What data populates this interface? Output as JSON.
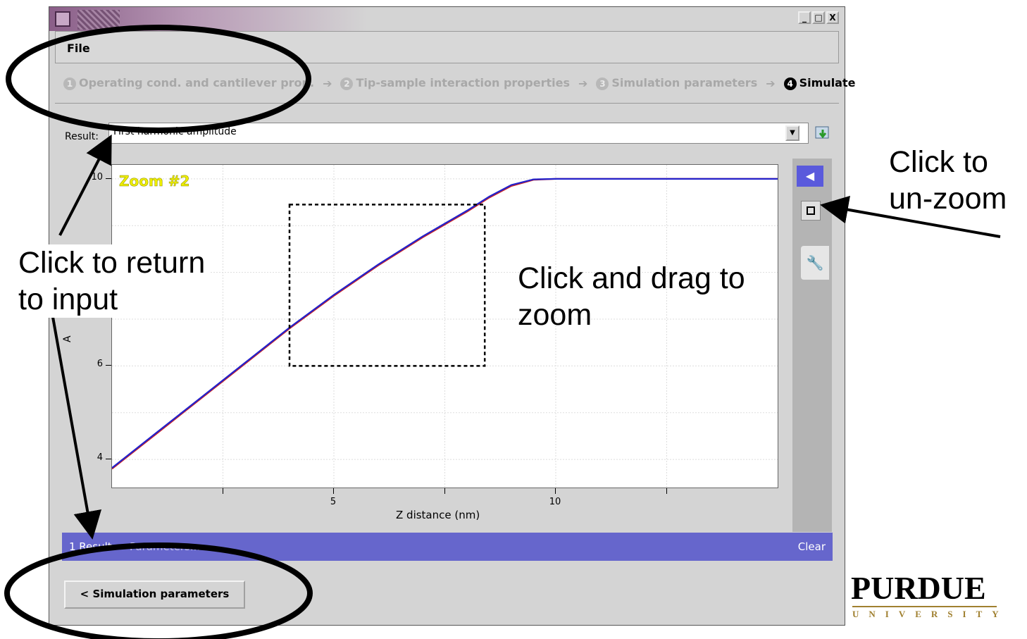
{
  "window": {
    "buttons": [
      "_",
      "□",
      "X"
    ]
  },
  "menu": {
    "file": "File"
  },
  "steps": [
    {
      "num": "1",
      "label": "Operating cond. and cantilever prop."
    },
    {
      "num": "2",
      "label": "Tip-sample interaction properties"
    },
    {
      "num": "3",
      "label": "Simulation parameters"
    },
    {
      "num": "4",
      "label": "Simulate"
    }
  ],
  "result_selector": {
    "label": "Result:",
    "value": "First harmonic amplitude"
  },
  "chart_data": {
    "type": "line",
    "zoom_label": "Zoom #2",
    "xlabel": "Z distance (nm)",
    "ylabel": "A",
    "x_ticks": [
      "5",
      "10"
    ],
    "y_ticks": [
      "4",
      "6",
      "10"
    ],
    "xlim": [
      0,
      15
    ],
    "ylim": [
      3.4,
      10.3
    ],
    "series": [
      {
        "color": "#cc2222",
        "x": [
          0,
          1,
          2,
          3,
          4,
          5,
          6,
          7,
          8,
          8.5,
          9,
          9.5,
          10,
          11,
          12,
          13,
          14,
          15
        ],
        "y": [
          3.8,
          4.55,
          5.3,
          6.05,
          6.8,
          7.5,
          8.15,
          8.75,
          9.3,
          9.6,
          9.85,
          9.98,
          10,
          10,
          10,
          10,
          10,
          10
        ]
      },
      {
        "color": "#2222cc",
        "x": [
          0,
          1,
          2,
          3,
          4,
          5,
          6,
          7,
          8,
          8.5,
          9,
          9.5,
          10,
          11,
          12,
          13,
          14,
          15
        ],
        "y": [
          3.82,
          4.57,
          5.32,
          6.07,
          6.82,
          7.52,
          8.17,
          8.77,
          9.32,
          9.62,
          9.87,
          9.99,
          10,
          10,
          10,
          10,
          10,
          10
        ]
      }
    ],
    "zoom_box": {
      "x": [
        4.0,
        8.4
      ],
      "y": [
        6.0,
        9.45
      ]
    },
    "grid": true
  },
  "result_bar": {
    "result": "1 Result",
    "parameters": "Parameters...",
    "clear": "Clear"
  },
  "back_button": "< Simulation parameters",
  "annotations": {
    "unzoom": [
      "Click to",
      "un-zoom"
    ],
    "drag": [
      "Click and drag to",
      "zoom"
    ],
    "return": [
      "Click to return",
      "to input"
    ]
  },
  "logo": {
    "name": "PURDUE",
    "sub": "UNIVERSITY"
  },
  "colors": {
    "result_bar": "#6666cc",
    "tool_back": "#5a5adc",
    "purdue_gold": "#a08030"
  }
}
